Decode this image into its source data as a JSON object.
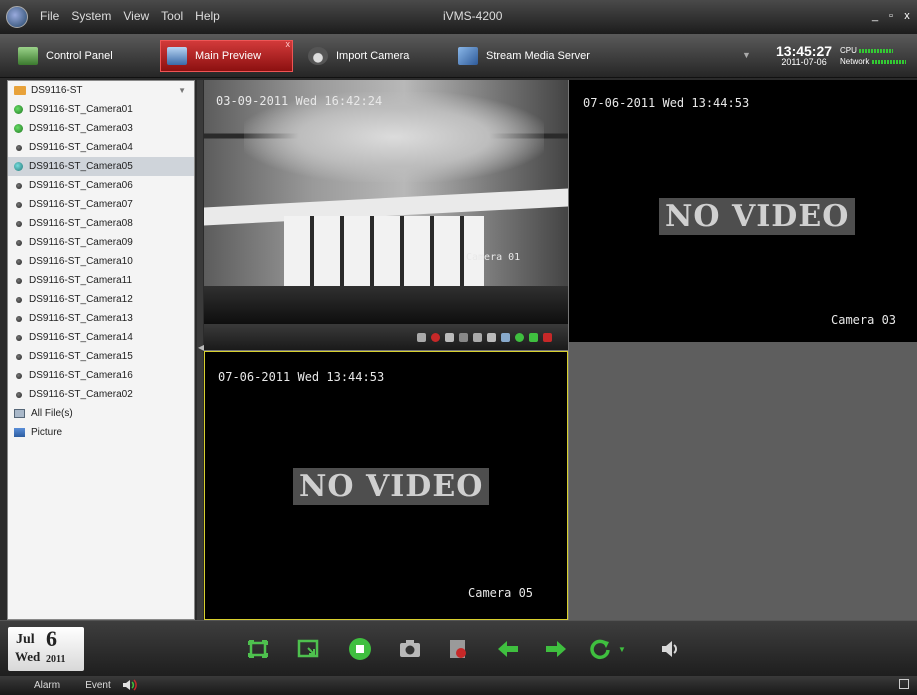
{
  "titlebar": {
    "menu": [
      "File",
      "System",
      "View",
      "Tool",
      "Help"
    ],
    "title": "iVMS-4200",
    "min_label": "_",
    "max_label": "▫",
    "close_label": "x"
  },
  "tabs": [
    {
      "label": "Control Panel",
      "icon": "monitor-icon"
    },
    {
      "label": "Main Preview",
      "icon": "screen-icon",
      "close": "x"
    },
    {
      "label": "Import Camera",
      "icon": "camera-icon"
    },
    {
      "label": "Stream Media Server",
      "icon": "server-icon"
    }
  ],
  "clock": {
    "time": "13:45:27",
    "date": "2011-07-06"
  },
  "sysinfo": {
    "cpu_label": "CPU",
    "network_label": "Network"
  },
  "sidebar": {
    "root": "DS9116-ST",
    "cameras": [
      {
        "label": "DS9116-ST_Camera01",
        "status": "green"
      },
      {
        "label": "DS9116-ST_Camera03",
        "status": "green"
      },
      {
        "label": "DS9116-ST_Camera04",
        "status": "dark"
      },
      {
        "label": "DS9116-ST_Camera05",
        "status": "teal",
        "selected": true
      },
      {
        "label": "DS9116-ST_Camera06",
        "status": "dark"
      },
      {
        "label": "DS9116-ST_Camera07",
        "status": "dark"
      },
      {
        "label": "DS9116-ST_Camera08",
        "status": "dark"
      },
      {
        "label": "DS9116-ST_Camera09",
        "status": "dark"
      },
      {
        "label": "DS9116-ST_Camera10",
        "status": "dark"
      },
      {
        "label": "DS9116-ST_Camera11",
        "status": "dark"
      },
      {
        "label": "DS9116-ST_Camera12",
        "status": "dark"
      },
      {
        "label": "DS9116-ST_Camera13",
        "status": "dark"
      },
      {
        "label": "DS9116-ST_Camera14",
        "status": "dark"
      },
      {
        "label": "DS9116-ST_Camera15",
        "status": "dark"
      },
      {
        "label": "DS9116-ST_Camera16",
        "status": "dark"
      },
      {
        "label": "DS9116-ST_Camera02",
        "status": "dark"
      }
    ],
    "all_files": "All File(s)",
    "picture": "Picture"
  },
  "panes": [
    {
      "time": "03-09-2011 Wed 16:42:24",
      "camera": "Camera 01",
      "no_video": ""
    },
    {
      "time": "07-06-2011 Wed 13:44:53",
      "camera": "Camera 03",
      "no_video": "NO VIDEO"
    },
    {
      "time": "07-06-2011 Wed 13:44:53",
      "camera": "Camera 05",
      "no_video": "NO VIDEO"
    }
  ],
  "pane_toolbar_icons": [
    "snapshot-icon",
    "record-icon",
    "talk-icon",
    "zoom-icon",
    "ptz-icon",
    "stream-icon",
    "camera-status-icon",
    "play-icon",
    "refresh-icon",
    "audio-icon"
  ],
  "colors": {
    "accent": "#c62828",
    "active_pane_border": "#d8d02e",
    "ok": "#33cc33"
  },
  "calendar": {
    "month": "Jul",
    "day": "6",
    "weekday": "Wed",
    "year": "2011"
  },
  "controls": [
    "fullscreen-icon",
    "layout-icon",
    "stop-all-icon",
    "capture-icon",
    "stop-record-icon",
    "previous-page-icon",
    "next-page-icon",
    "cycle-icon",
    "audio-volume-icon"
  ],
  "status": {
    "alarm": "Alarm",
    "event": "Event"
  }
}
